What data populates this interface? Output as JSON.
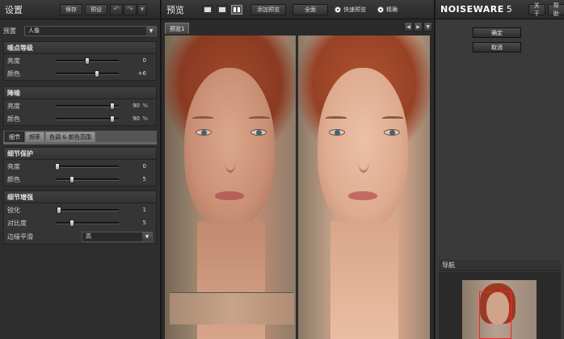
{
  "left": {
    "title": "设置",
    "save_label": "保存",
    "preset_btn_label": "预设",
    "preset_label": "预置",
    "preset_value": "人像",
    "noise_level": {
      "title": "噪点等级",
      "rows": [
        {
          "label": "亮度",
          "value": "0",
          "pos": 0.5
        },
        {
          "label": "颜色",
          "value": "+6",
          "pos": 0.65
        }
      ]
    },
    "denoise": {
      "title": "降噪",
      "rows": [
        {
          "label": "亮度",
          "value": "90",
          "unit": "%",
          "pos": 0.9
        },
        {
          "label": "颜色",
          "value": "90",
          "unit": "%",
          "pos": 0.9
        }
      ]
    },
    "tabs": [
      "细节",
      "频率",
      "色调 & 颜色范围"
    ],
    "detail_protect": {
      "title": "细节保护",
      "rows": [
        {
          "label": "亮度",
          "value": "0",
          "pos": 0.0
        },
        {
          "label": "颜色",
          "value": "5",
          "pos": 0.25
        }
      ]
    },
    "detail_enhance": {
      "title": "细节增强",
      "rows": [
        {
          "label": "锐化",
          "value": "1",
          "pos": 0.05
        },
        {
          "label": "对比度",
          "value": "5",
          "pos": 0.25
        }
      ],
      "edge_label": "边缘平滑",
      "edge_value": "高"
    }
  },
  "center": {
    "title": "预览",
    "add_preview": "添加预览",
    "full_screen": "全面",
    "fast_preview": "快速预览",
    "accurate": "精确",
    "tab_label": "预览1"
  },
  "right": {
    "brand": "NOISEWARE",
    "version": "5",
    "about": "关于",
    "help": "帮助",
    "ok": "确定",
    "cancel": "取消",
    "navigator": "导航"
  },
  "icons": {
    "undo": "undo-icon",
    "redo": "redo-icon",
    "menu": "dropdown-arrow-icon",
    "view_single": "single-view-icon",
    "view_split_h": "split-horizontal-icon",
    "view_split_v": "split-vertical-icon"
  },
  "colors": {
    "panel_bg": "#2e2e2e",
    "nav_rect": "#ff2020"
  }
}
